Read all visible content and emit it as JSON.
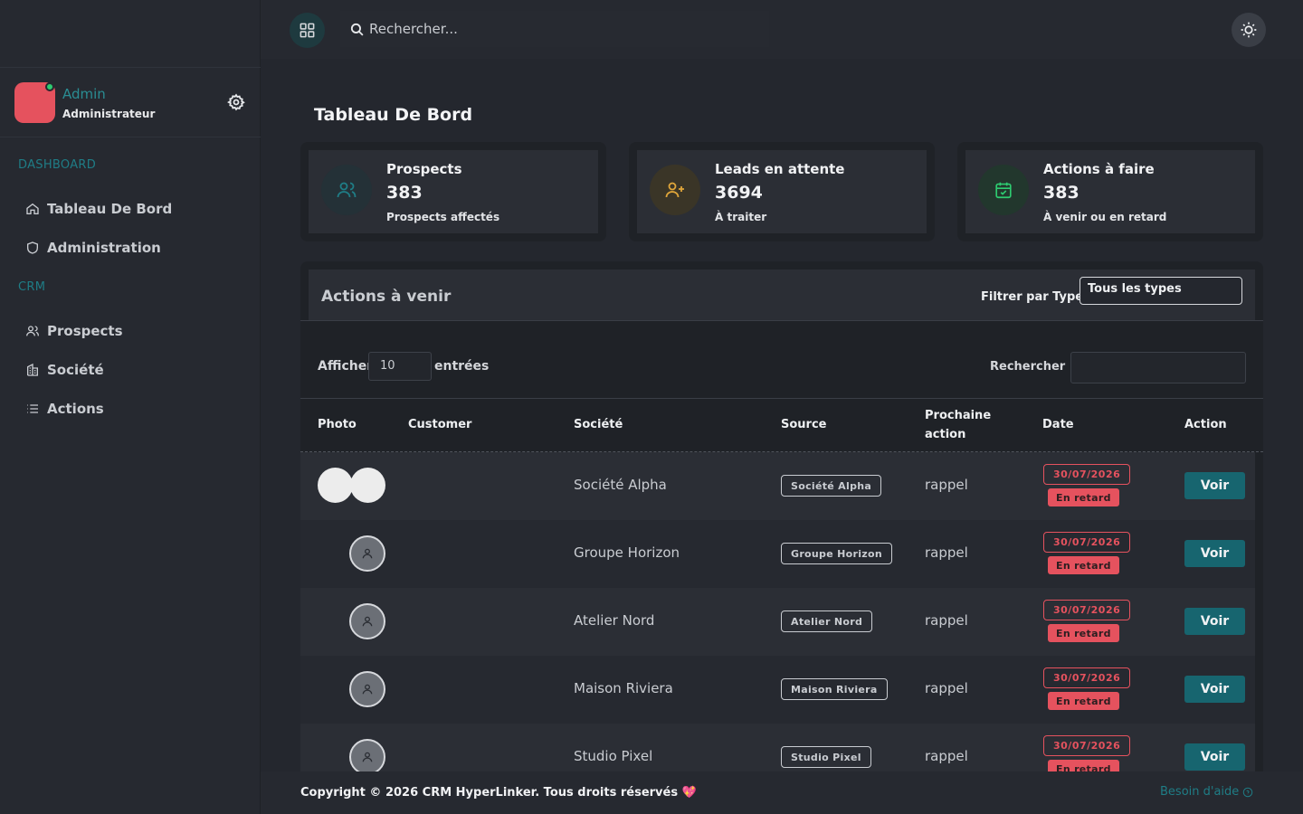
{
  "user": {
    "name": "Admin",
    "role": "Administrateur"
  },
  "sidebar": {
    "sections": [
      {
        "label": "DASHBOARD",
        "items": [
          {
            "label": "Tableau De Bord",
            "icon": "home-icon"
          },
          {
            "label": "Administration",
            "icon": "shield-icon"
          }
        ]
      },
      {
        "label": "CRM",
        "items": [
          {
            "label": "Prospects",
            "icon": "users-icon"
          },
          {
            "label": "Société",
            "icon": "building-icon"
          },
          {
            "label": "Actions",
            "icon": "list-icon"
          }
        ]
      }
    ]
  },
  "topbar": {
    "search_placeholder": "Rechercher..."
  },
  "page": {
    "title": "Tableau De Bord"
  },
  "stats": [
    {
      "label": "Prospects",
      "value": "383",
      "sub": "Prospects affectés",
      "icon": "users-icon",
      "color": "#1f7d86"
    },
    {
      "label": "Leads en attente",
      "value": "3694",
      "sub": "À traiter",
      "icon": "user-plus-icon",
      "color": "#e0a63a"
    },
    {
      "label": "Actions à faire",
      "value": "383",
      "sub": "À venir ou en retard",
      "icon": "calendar-check-icon",
      "color": "#2ecc71"
    }
  ],
  "panel": {
    "title": "Actions à venir",
    "filter_label": "Filtrer par Type:",
    "filter_value": "Tous les types",
    "show_label": "Afficher",
    "show_value": "10",
    "entries_label": "entrées",
    "search_label": "Rechercher :"
  },
  "table": {
    "headers": [
      "Photo",
      "Customer",
      "Société",
      "Source",
      "Prochaine action",
      "Date",
      "Action"
    ],
    "rows": [
      {
        "societe": "Société Alpha",
        "source": "Société Alpha",
        "next": "rappel",
        "date": "30/07/2026",
        "status": "En retard",
        "action": "Voir"
      },
      {
        "societe": "Groupe Horizon",
        "source": "Groupe Horizon",
        "next": "rappel",
        "date": "30/07/2026",
        "status": "En retard",
        "action": "Voir"
      },
      {
        "societe": "Atelier Nord",
        "source": "Atelier Nord",
        "next": "rappel",
        "date": "30/07/2026",
        "status": "En retard",
        "action": "Voir"
      },
      {
        "societe": "Maison Riviera",
        "source": "Maison Riviera",
        "next": "rappel",
        "date": "30/07/2026",
        "status": "En retard",
        "action": "Voir"
      },
      {
        "societe": "Studio Pixel",
        "source": "Studio Pixel",
        "next": "rappel",
        "date": "30/07/2026",
        "status": "En retard",
        "action": "Voir"
      }
    ]
  },
  "footer": {
    "copyright": "Copyright © 2026 CRM HyperLinker. Tous droits réservés 💖",
    "help": "Besoin d'aide"
  }
}
